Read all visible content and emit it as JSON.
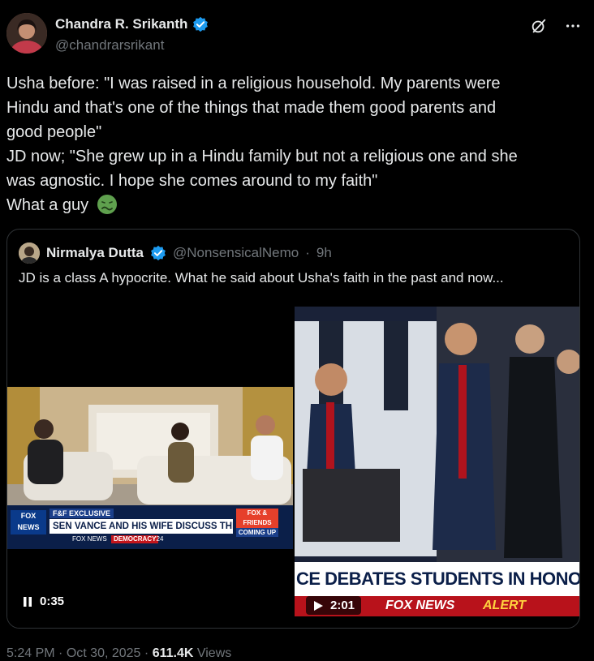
{
  "author": {
    "name": "Chandra R. Srikanth",
    "handle": "@chandrarsrikant"
  },
  "header_icons": [
    "grok-icon",
    "more-icon"
  ],
  "tweet": {
    "lines": [
      "Usha before: \"I was raised in a religious household. My parents were",
      "Hindu and that's one of the things that made them good parents and",
      "good people\"",
      "JD now; \"She grew up in a Hindu family but not a religious one and she",
      "was agnostic. I hope she comes around to my faith\"",
      "What a guy"
    ],
    "emoji": "nauseated-face"
  },
  "quote": {
    "name": "Nirmalya Dutta",
    "handle": "@NonsensicalNemo",
    "separator": "·",
    "time": "9h",
    "text": "JD is a class A hypocrite. What he said about Usha's faith in the past and now...",
    "media_left": {
      "badge_time": "0:35",
      "state": "paused",
      "chyron_tag": "F&F EXCLUSIVE",
      "chyron_title": "SEN VANCE AND HIS WIFE DISCUSS THEIR FAITH",
      "network": "FOX NEWS",
      "ticker": "DEMOCRACY",
      "ticker_num": "'24",
      "corner_label": "FOX & FRIENDS",
      "corner_sub": "COMING UP"
    },
    "media_right": {
      "badge_time": "2:01",
      "state": "play",
      "chyron_title": "CE DEBATES STUDENTS IN HONOR",
      "network": "FOX NEWS",
      "alert": "ALERT"
    }
  },
  "footer": {
    "time": "5:24 PM",
    "date": "Oct 30, 2025",
    "views": "611.4K",
    "views_label": "Views",
    "sep": "·"
  },
  "colors": {
    "background": "#000000",
    "text": "#e7e9ea",
    "muted": "#71767b",
    "verified": "#1d9bf0",
    "border": "#2f3336"
  }
}
